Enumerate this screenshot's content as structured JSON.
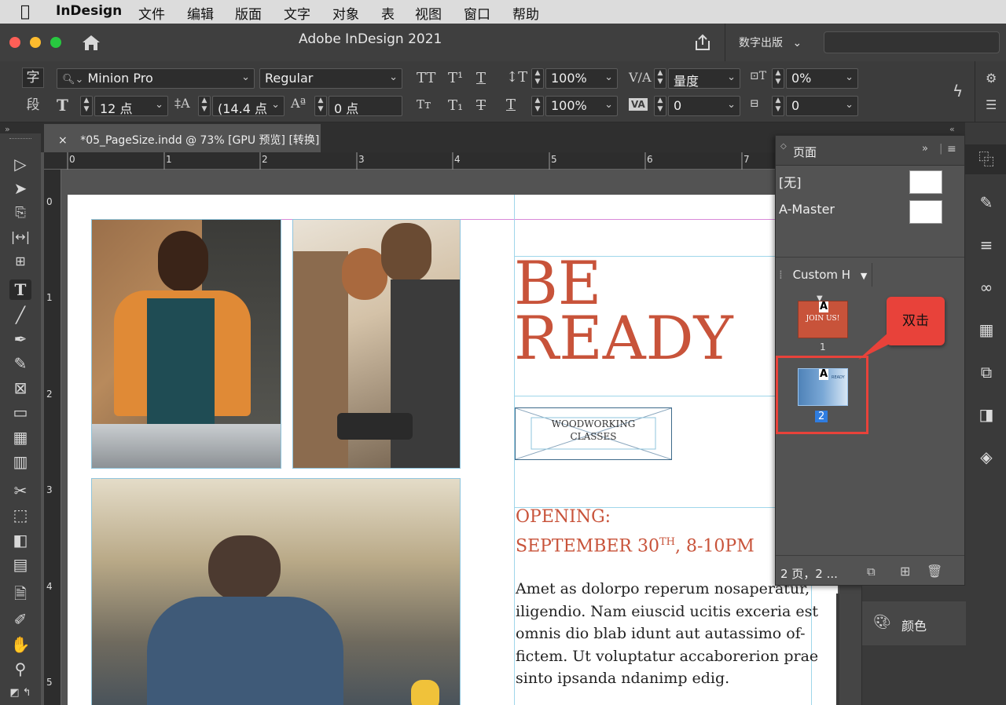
{
  "menubar": {
    "app_name": "InDesign",
    "items": [
      "文件",
      "编辑",
      "版面",
      "文字",
      "对象",
      "表",
      "视图",
      "窗口",
      "帮助"
    ]
  },
  "titlebar": {
    "title": "Adobe InDesign 2021",
    "publish_label": "数字出版"
  },
  "control_panel": {
    "char_mode_label": "字",
    "para_mode_label": "段",
    "font_family": "Minion Pro",
    "font_style": "Regular",
    "font_size": "12 点",
    "leading": "(14.4 点",
    "baseline_shift": "0 点",
    "vertical_scale": "100%",
    "horizontal_scale": "100%",
    "kerning": "量度",
    "tracking": "0",
    "skew": "0%",
    "char_rotation": "0"
  },
  "document_tab": {
    "close_glyph": "×",
    "title": "*05_PageSize.indd @ 73% [GPU 预览] [转换]"
  },
  "rulers": {
    "h_labels": [
      "0",
      "1",
      "2",
      "3",
      "4",
      "5",
      "6",
      "7"
    ],
    "v_labels": [
      "0",
      "1",
      "2",
      "3",
      "4",
      "5"
    ]
  },
  "document": {
    "headline_line1": "BE",
    "headline_line2": "READY",
    "box_line1": "WOODWORKING",
    "box_line2": "CLASSES",
    "opening_line1": "OPENING:",
    "opening_line2a": "SEPTEMBER 30",
    "opening_sup": "TH",
    "opening_line2b": ", 8-10PM",
    "body_lines": [
      "Amet as dolorpo reperum nosaperatur,",
      "iligendio. Nam eiuscid ucitis exceria est",
      "omnis dio blab idunt aut autassimo of-",
      "fictem. Ut voluptatur accaborerion prae",
      "sinto ipsanda ndanimp edig."
    ],
    "accent_color": "#c8533a"
  },
  "pages_panel": {
    "title": "页面",
    "masters": [
      {
        "label": "[无]"
      },
      {
        "label": "A-Master"
      }
    ],
    "size_dropdown": "Custom H",
    "page1": {
      "number": "1",
      "master_letter": "A",
      "thumb_text": "JOIN US!"
    },
    "page2": {
      "number": "2",
      "master_letter": "A",
      "thumb_text": "READY"
    },
    "status": "2 页，2 ...",
    "callout": "双击",
    "callout_color": "#e8423a"
  },
  "color_panel": {
    "label": "颜色"
  }
}
